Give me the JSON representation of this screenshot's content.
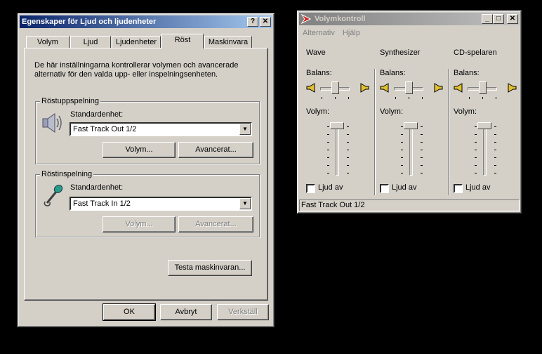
{
  "properties_window": {
    "title": "Egenskaper för Ljud och ljudenheter",
    "help_button": "?",
    "close_button": "✕",
    "tabs": [
      {
        "label": "Volym"
      },
      {
        "label": "Ljud"
      },
      {
        "label": "Ljudenheter"
      },
      {
        "label": "Röst"
      },
      {
        "label": "Maskinvara"
      }
    ],
    "selected_tab": "Röst",
    "description": "De här inställningarna kontrollerar volymen och avancerade alternativ för den valda upp- eller inspelningsenheten.",
    "playback": {
      "group_label": "Röstuppspelning",
      "device_label": "Standardenhet:",
      "device_value": "Fast Track Out 1/2",
      "volume_button": "Volym...",
      "advanced_button": "Avancerat..."
    },
    "recording": {
      "group_label": "Röstinspelning",
      "device_label": "Standardenhet:",
      "device_value": "Fast Track In 1/2",
      "volume_button": "Volym...",
      "advanced_button": "Avancerat..."
    },
    "test_button": "Testa maskinvaran...",
    "ok_button": "OK",
    "cancel_button": "Avbryt",
    "apply_button": "Verkställ"
  },
  "volume_window": {
    "title": "Volymkontroll",
    "menu": [
      "Alternativ",
      "Hjälp"
    ],
    "channels": [
      {
        "name": "Wave",
        "balance_label": "Balans:",
        "volume_label": "Volym:",
        "mute_label": "Ljud av",
        "muted": false
      },
      {
        "name": "Synthesizer",
        "balance_label": "Balans:",
        "volume_label": "Volym:",
        "mute_label": "Ljud av",
        "muted": false
      },
      {
        "name": "CD-spelaren",
        "balance_label": "Balans:",
        "volume_label": "Volym:",
        "mute_label": "Ljud av",
        "muted": false
      }
    ],
    "status": "Fast Track Out 1/2"
  }
}
